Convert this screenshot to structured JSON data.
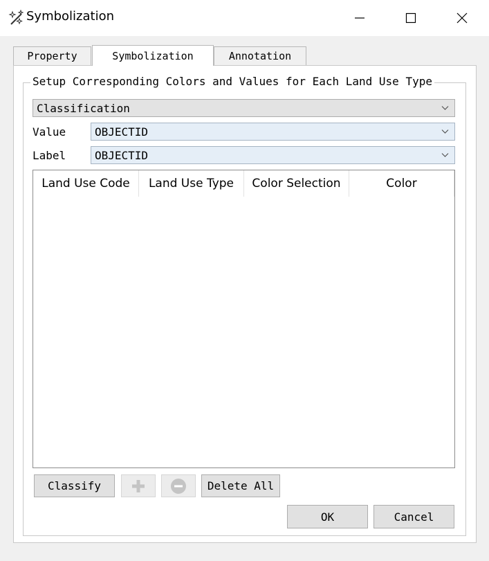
{
  "window": {
    "title": "Symbolization",
    "controls": {
      "minimize": "—",
      "maximize": "☐",
      "close": "✕"
    }
  },
  "tabs": [
    {
      "label": "Property",
      "active": false
    },
    {
      "label": "Symbolization",
      "active": true
    },
    {
      "label": "Annotation",
      "active": false
    }
  ],
  "group": {
    "title": "Setup Corresponding Colors and Values for Each Land Use Type"
  },
  "method_combo": {
    "value": "Classification"
  },
  "value_field": {
    "label": "Value",
    "value": "OBJECTID"
  },
  "label_field": {
    "label": "Label",
    "value": "OBJECTID"
  },
  "table": {
    "columns": [
      "Land Use Code",
      "Land Use Type",
      "Color Selection",
      "Color"
    ],
    "rows": []
  },
  "buttons": {
    "classify": "Classify",
    "delete_all": "Delete All",
    "ok": "OK",
    "cancel": "Cancel"
  },
  "icons": {
    "app": "magic-wand-sparkles-icon",
    "add": "plus-icon",
    "remove": "minus-circle-icon",
    "dropdown": "chevron-down-icon"
  },
  "colors": {
    "disabled_icon": "#c4c4c4",
    "combo_blue": "#e5eef7",
    "button_face": "#e1e1e1"
  }
}
